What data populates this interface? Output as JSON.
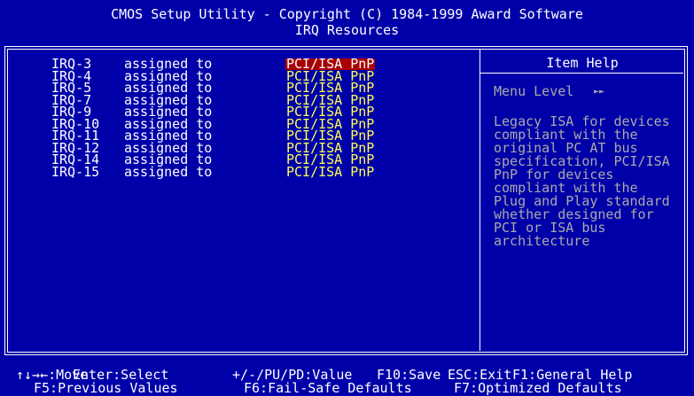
{
  "header": {
    "title": "CMOS Setup Utility - Copyright (C) 1984-1999 Award Software",
    "subtitle": "IRQ Resources"
  },
  "irq_rows": [
    {
      "name": "IRQ-3",
      "assign": "assigned to",
      "value": "PCI/ISA PnP",
      "selected": true
    },
    {
      "name": "IRQ-4",
      "assign": "assigned to",
      "value": "PCI/ISA PnP",
      "selected": false
    },
    {
      "name": "IRQ-5",
      "assign": "assigned to",
      "value": "PCI/ISA PnP",
      "selected": false
    },
    {
      "name": "IRQ-7",
      "assign": "assigned to",
      "value": "PCI/ISA PnP",
      "selected": false
    },
    {
      "name": "IRQ-9",
      "assign": "assigned to",
      "value": "PCI/ISA PnP",
      "selected": false
    },
    {
      "name": "IRQ-10",
      "assign": "assigned to",
      "value": "PCI/ISA PnP",
      "selected": false
    },
    {
      "name": "IRQ-11",
      "assign": "assigned to",
      "value": "PCI/ISA PnP",
      "selected": false
    },
    {
      "name": "IRQ-12",
      "assign": "assigned to",
      "value": "PCI/ISA PnP",
      "selected": false
    },
    {
      "name": "IRQ-14",
      "assign": "assigned to",
      "value": "PCI/ISA PnP",
      "selected": false
    },
    {
      "name": "IRQ-15",
      "assign": "assigned to",
      "value": "PCI/ISA PnP",
      "selected": false
    }
  ],
  "help": {
    "title": "Item Help",
    "menu_level_label": "Menu Level",
    "menu_level_arrow": "►►",
    "lines": [
      "Legacy ISA for devices",
      "compliant with the",
      "original PC AT bus",
      "specification, PCI/ISA",
      "PnP for devices",
      "compliant with the",
      "Plug and Play standard",
      "whether designed for",
      "PCI or ISA bus",
      "architecture"
    ]
  },
  "footer": {
    "row1": [
      {
        "label": "↑↓→←:Move",
        "x": 0
      },
      {
        "label": "Enter:Select",
        "x": 0
      },
      {
        "label": "+/-/PU/PD:Value",
        "x": 0
      },
      {
        "label": "F10:Save",
        "x": 0
      },
      {
        "label": "ESC:Exit",
        "x": 0
      },
      {
        "label": "F1:General Help",
        "x": 0
      }
    ],
    "row2": [
      {
        "label": "F5:Previous Values"
      },
      {
        "label": "F6:Fail-Safe Defaults"
      },
      {
        "label": "F7:Optimized Defaults"
      }
    ]
  },
  "colors": {
    "background": "#0000a8",
    "value_text": "#ffff55",
    "selected_bg": "#a80000",
    "help_text": "#aaaaaa",
    "text": "#ffffff"
  }
}
